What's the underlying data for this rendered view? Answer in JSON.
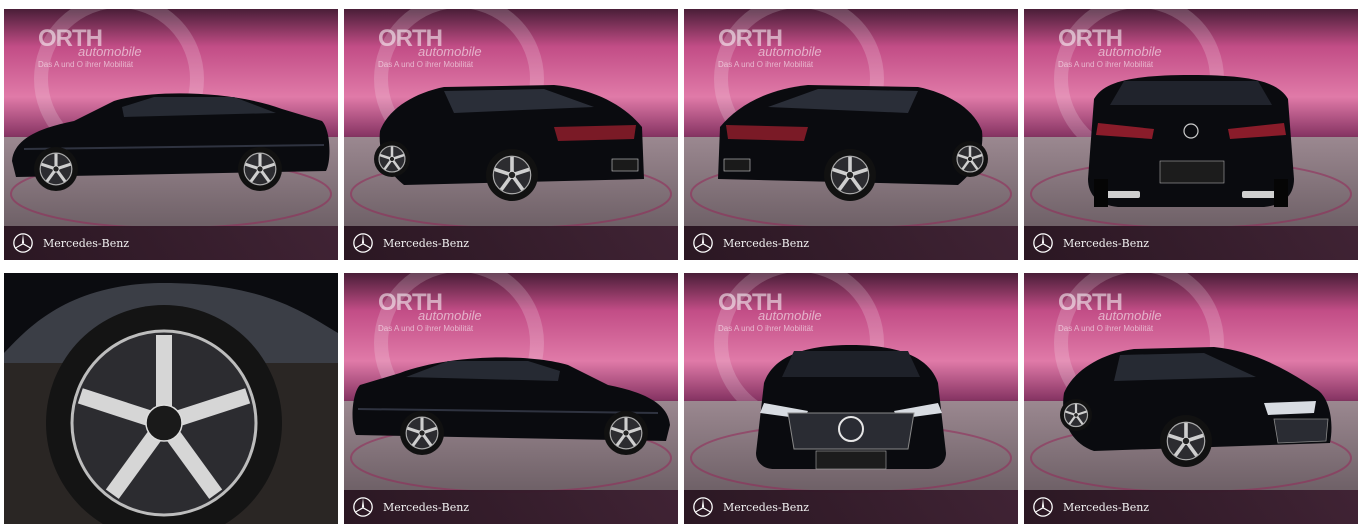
{
  "dealer": {
    "logo_name": "ORTH",
    "logo_sub": "automobile",
    "tagline": "Das A und O ihrer Mobilität"
  },
  "brand": {
    "name": "Mercedes-Benz",
    "icon": "mercedes-star-icon"
  },
  "photos": [
    {
      "view": "side-left",
      "has_logo": true,
      "has_brand_bar": true
    },
    {
      "view": "rear-three-quarter-left",
      "has_logo": true,
      "has_brand_bar": true
    },
    {
      "view": "rear-three-quarter-right",
      "has_logo": true,
      "has_brand_bar": true
    },
    {
      "view": "rear",
      "has_logo": true,
      "has_brand_bar": true
    },
    {
      "view": "wheel-closeup",
      "has_logo": false,
      "has_brand_bar": false
    },
    {
      "view": "side-right",
      "has_logo": true,
      "has_brand_bar": true
    },
    {
      "view": "front",
      "has_logo": true,
      "has_brand_bar": true
    },
    {
      "view": "front-three-quarter-right",
      "has_logo": true,
      "has_brand_bar": true
    }
  ],
  "colors": {
    "backdrop_top": "#c94f8c",
    "backdrop_dark": "#3a1a2c",
    "floor": "#7d6e74",
    "car": "#0a0b0f",
    "brand_bar": "#2b1a25"
  }
}
